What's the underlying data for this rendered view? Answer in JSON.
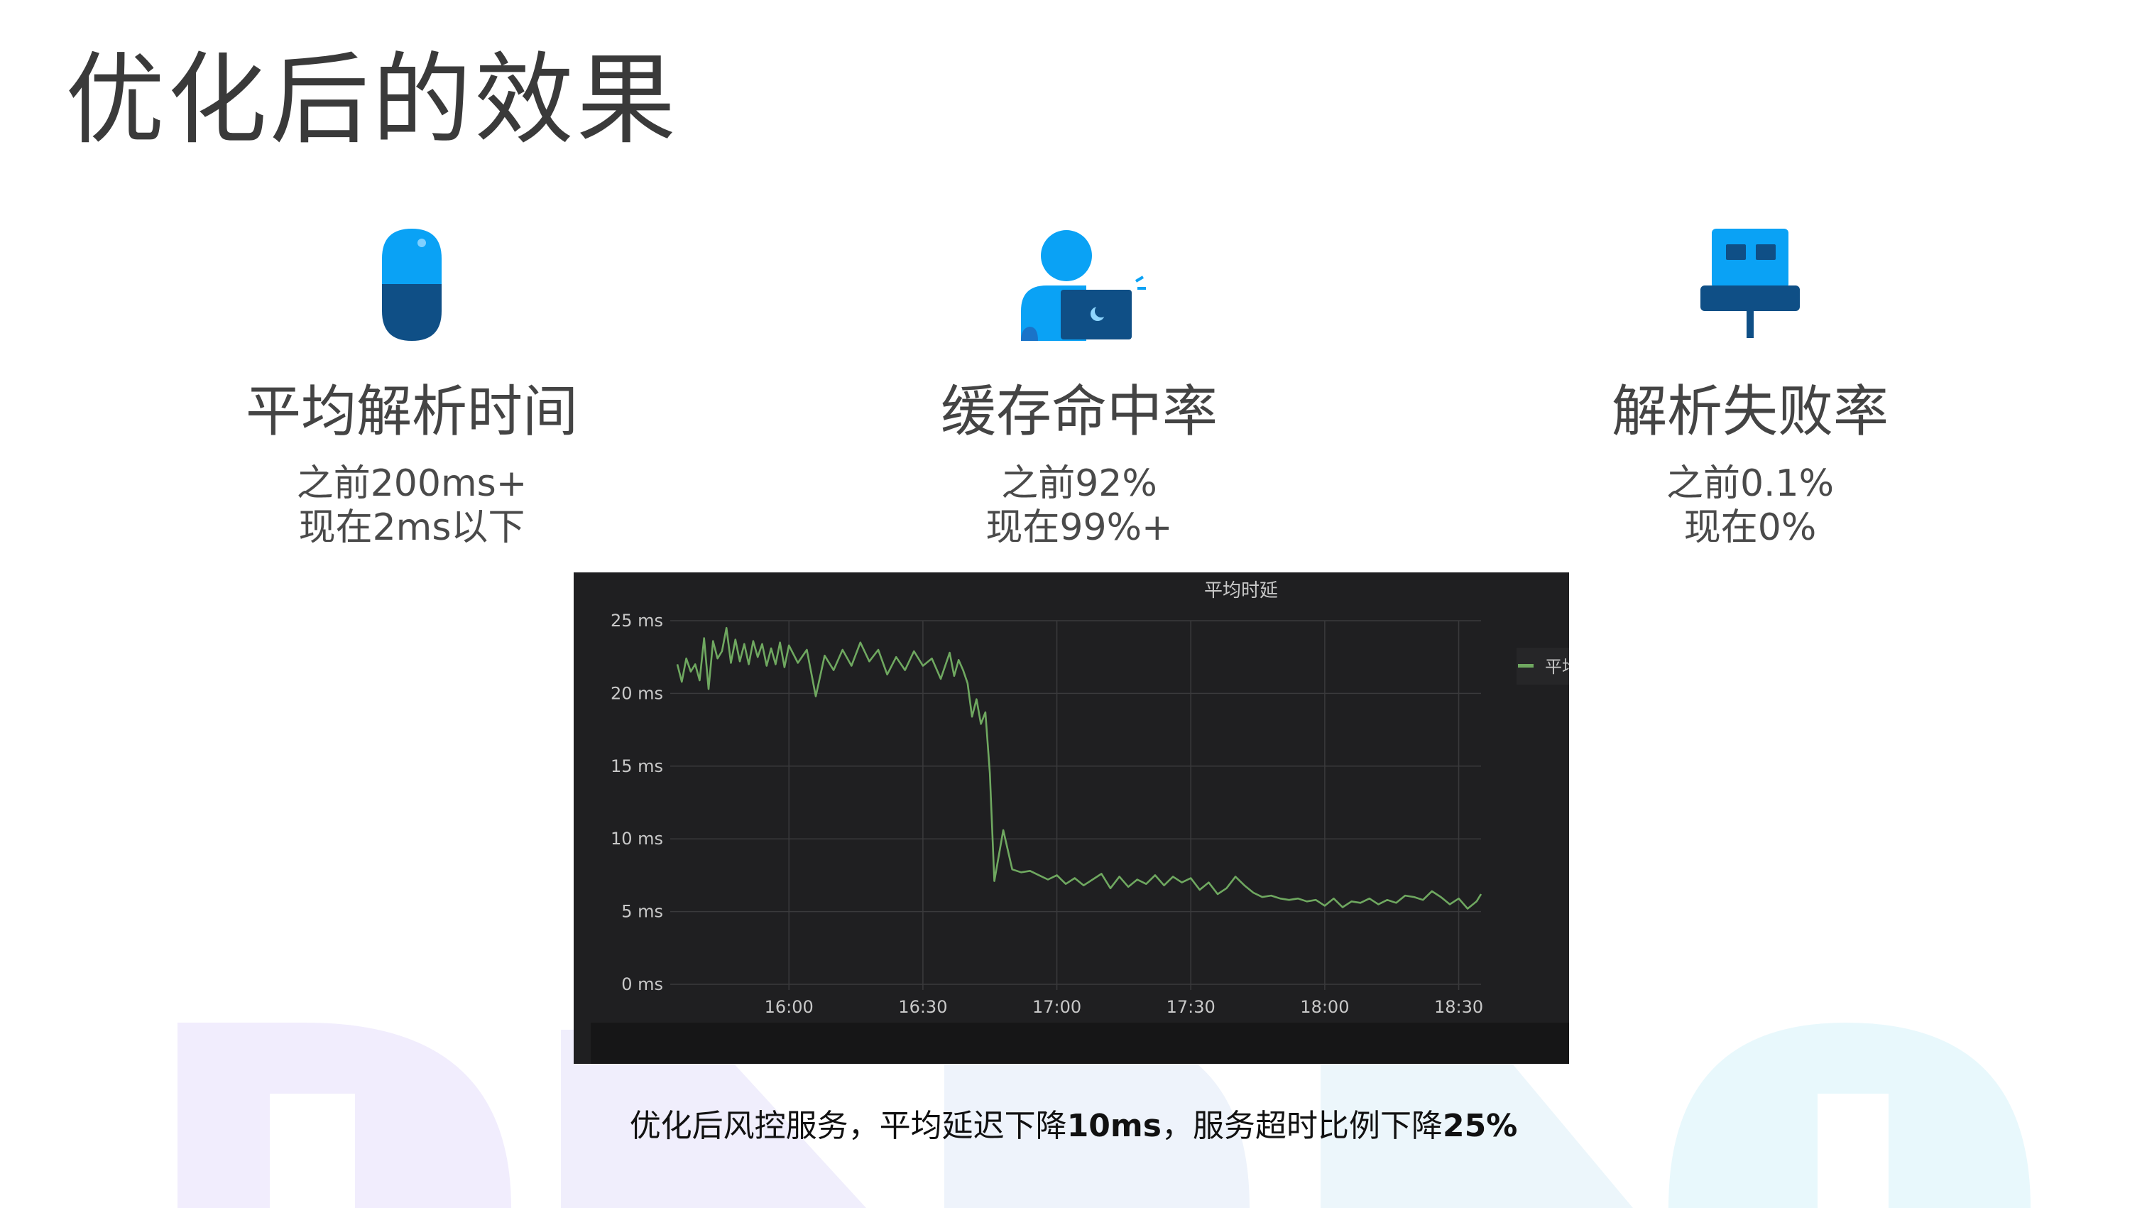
{
  "slide": {
    "title": "优化后的效果"
  },
  "metrics": [
    {
      "icon": "capsule-icon",
      "title": "平均解析时间",
      "before": "之前200ms+",
      "after": "现在2ms以下"
    },
    {
      "icon": "person-laptop-icon",
      "title": "缓存命中率",
      "before": "之前92%",
      "after": "现在99%+"
    },
    {
      "icon": "plug-icon",
      "title": "解析失败率",
      "before": "之前0.1%",
      "after": "现在0%"
    }
  ],
  "caption": {
    "part1": "优化后风控服务，平均延迟下降",
    "bold1": "10ms",
    "part2": "，服务超时比例下降",
    "bold2": "25%"
  },
  "colors": {
    "background": "#ffffff",
    "icon_light_blue": "#0aa2f5",
    "icon_dark_blue": "#0f4f86",
    "panel_bg": "#1f1f21",
    "line": "#6fa860",
    "grid": "#3a3a3c",
    "tick_text": "#c8c8c8"
  },
  "chart_data": {
    "type": "line",
    "title": "平均时延",
    "legend": [
      "平均时延"
    ],
    "legend_position": "right",
    "grid": true,
    "x_ticks": [
      "16:00",
      "16:30",
      "17:00",
      "17:30",
      "18:00",
      "18:30"
    ],
    "y_ticks": [
      "0 ms",
      "5 ms",
      "10 ms",
      "15 ms",
      "20 ms",
      "25 ms"
    ],
    "ylim": [
      0,
      25
    ],
    "xlim": [
      "15:35",
      "18:35"
    ],
    "series": [
      {
        "name": "平均时延",
        "x": [
          "15:35",
          "15:36",
          "15:37",
          "15:38",
          "15:39",
          "15:40",
          "15:41",
          "15:42",
          "15:43",
          "15:44",
          "15:45",
          "15:46",
          "15:47",
          "15:48",
          "15:49",
          "15:50",
          "15:51",
          "15:52",
          "15:53",
          "15:54",
          "15:55",
          "15:56",
          "15:57",
          "15:58",
          "15:59",
          "16:00",
          "16:02",
          "16:04",
          "16:06",
          "16:08",
          "16:10",
          "16:12",
          "16:14",
          "16:16",
          "16:18",
          "16:20",
          "16:22",
          "16:24",
          "16:26",
          "16:28",
          "16:30",
          "16:32",
          "16:34",
          "16:36",
          "16:37",
          "16:38",
          "16:39",
          "16:40",
          "16:41",
          "16:42",
          "16:43",
          "16:44",
          "16:45",
          "16:46",
          "16:48",
          "16:50",
          "16:52",
          "16:54",
          "16:56",
          "16:58",
          "17:00",
          "17:02",
          "17:04",
          "17:06",
          "17:08",
          "17:10",
          "17:12",
          "17:14",
          "17:16",
          "17:18",
          "17:20",
          "17:22",
          "17:24",
          "17:26",
          "17:28",
          "17:30",
          "17:32",
          "17:34",
          "17:36",
          "17:38",
          "17:40",
          "17:42",
          "17:44",
          "17:46",
          "17:48",
          "17:50",
          "17:52",
          "17:54",
          "17:56",
          "17:58",
          "18:00",
          "18:02",
          "18:04",
          "18:06",
          "18:08",
          "18:10",
          "18:12",
          "18:14",
          "18:16",
          "18:18",
          "18:20",
          "18:22",
          "18:24",
          "18:26",
          "18:28",
          "18:30",
          "18:32",
          "18:34",
          "18:35"
        ],
        "values": [
          22.0,
          20.8,
          22.4,
          21.5,
          22.0,
          20.9,
          23.8,
          20.3,
          23.6,
          22.4,
          22.9,
          24.5,
          22.1,
          23.7,
          22.2,
          23.4,
          22.0,
          23.6,
          22.5,
          23.4,
          21.9,
          23.1,
          22.0,
          23.5,
          21.8,
          23.3,
          22.1,
          23.0,
          19.8,
          22.6,
          21.6,
          23.0,
          21.9,
          23.5,
          22.2,
          23.0,
          21.3,
          22.5,
          21.6,
          22.9,
          21.9,
          22.4,
          21.0,
          22.8,
          21.2,
          22.3,
          21.6,
          20.7,
          18.4,
          19.6,
          17.9,
          18.7,
          14.5,
          7.1,
          10.6,
          7.9,
          7.7,
          7.8,
          7.5,
          7.2,
          7.5,
          6.9,
          7.3,
          6.8,
          7.2,
          7.6,
          6.6,
          7.4,
          6.7,
          7.2,
          6.9,
          7.5,
          6.8,
          7.4,
          7.0,
          7.3,
          6.5,
          7.0,
          6.2,
          6.6,
          7.4,
          6.8,
          6.3,
          6.0,
          6.1,
          5.9,
          5.8,
          5.9,
          5.7,
          5.8,
          5.4,
          5.9,
          5.3,
          5.7,
          5.6,
          5.9,
          5.5,
          5.8,
          5.6,
          6.1,
          6.0,
          5.8,
          6.4,
          6.0,
          5.5,
          5.9,
          5.2,
          5.7,
          6.2
        ]
      }
    ]
  }
}
